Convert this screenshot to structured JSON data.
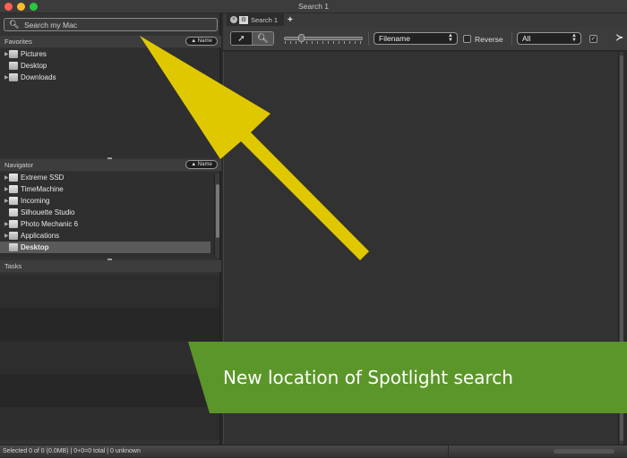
{
  "window": {
    "title": "Search 1"
  },
  "left_pane": {
    "search": {
      "placeholder": "Search my Mac",
      "value": ""
    },
    "favorites": {
      "header": "Favorites",
      "sort_label": "▲ Name",
      "items": [
        {
          "label": "Pictures",
          "expandable": true,
          "icon": "folder-icon"
        },
        {
          "label": "Desktop",
          "expandable": false,
          "icon": "folder-icon"
        },
        {
          "label": "Downloads",
          "expandable": true,
          "icon": "folder-icon"
        }
      ]
    },
    "navigator": {
      "header": "Navigator",
      "sort_label": "▲ Name",
      "items": [
        {
          "label": "Extreme SSD",
          "expandable": true,
          "icon": "drive-icon",
          "selected": false
        },
        {
          "label": "TimeMachine",
          "expandable": true,
          "icon": "timemachine-drive-icon",
          "selected": false
        },
        {
          "label": "Incoming",
          "expandable": true,
          "icon": "drive-icon",
          "selected": false
        },
        {
          "label": "Silhouette Studio",
          "expandable": false,
          "icon": "drive-icon",
          "selected": false
        },
        {
          "label": "Photo Mechanic 6",
          "expandable": true,
          "icon": "app-disk-icon",
          "selected": false
        },
        {
          "label": "Applications",
          "expandable": true,
          "icon": "applications-folder-icon",
          "selected": false
        },
        {
          "label": "Desktop",
          "expandable": false,
          "icon": "folder-icon",
          "selected": true
        }
      ]
    },
    "tasks": {
      "header": "Tasks",
      "items": []
    }
  },
  "tabs": {
    "items": [
      {
        "label": "Search 1",
        "icon": "gear-icon",
        "close": "×"
      }
    ],
    "add_label": "+"
  },
  "toolbar": {
    "tool_select_icon": "pointer-icon",
    "tool_zoom_icon": "magnifier-icon",
    "thumbnail_size": 0.2,
    "sort_field": "Filename",
    "reverse_label": "Reverse",
    "reverse_checked": false,
    "filter": "All",
    "filter_checked": true,
    "more_label": "≻"
  },
  "status": {
    "text": "Selected 0 of 0 (0.0MB) | 0+0=0 total | 0 unknown"
  },
  "annotation": {
    "text": "New location of Spotlight search",
    "banner_color": "#5b962a",
    "arrow_color": "#e0c800"
  }
}
